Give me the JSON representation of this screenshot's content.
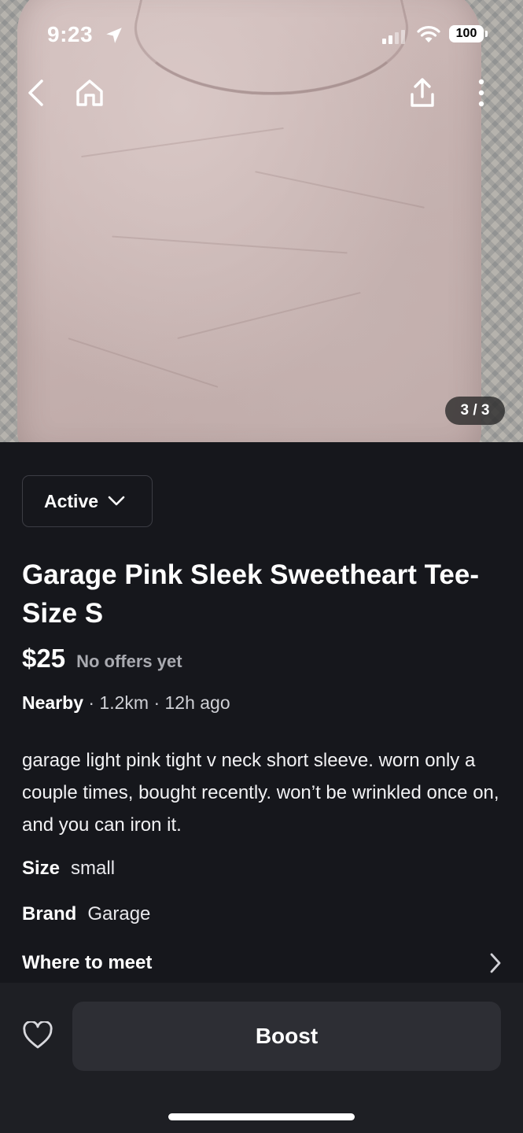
{
  "status_bar": {
    "time": "9:23",
    "battery": "100"
  },
  "photo": {
    "alt": "Light pink v-neck tee photo",
    "counter": "3 / 3"
  },
  "listing": {
    "status": "Active",
    "title": "Garage Pink Sleek Sweetheart Tee- Size S",
    "price": "$25",
    "offers": "No offers yet",
    "location_label": "Nearby",
    "meta_rest": " · 1.2km · 12h ago",
    "description": "garage light pink tight v neck short sleeve. worn only a couple times, bought recently. won’t be wrinkled once on, and you can iron it.",
    "attributes": [
      {
        "key": "Size",
        "value": "small"
      },
      {
        "key": "Brand",
        "value": "Garage"
      }
    ],
    "meet_label": "Where to meet"
  },
  "actions": {
    "boost_label": "Boost"
  },
  "icons": {
    "back": "chevron-left-icon",
    "home": "home-icon",
    "share": "share-icon",
    "more": "more-vertical-icon",
    "favorite": "heart-icon"
  },
  "colors": {
    "background": "#16171c",
    "bottom_bar": "#1e1f24",
    "button": "#2d2e34",
    "muted_text": "#a9aab0"
  }
}
